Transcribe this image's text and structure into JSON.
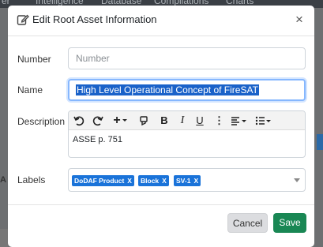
{
  "background": {
    "menu_items": [
      "er",
      "Intelligence",
      "Database",
      "Compilations",
      "Charts"
    ],
    "left_fragment": "A"
  },
  "modal": {
    "title": "Edit Root Asset Information",
    "close_symbol": "×",
    "fields": {
      "number": {
        "label": "Number",
        "placeholder": "Number",
        "value": ""
      },
      "name": {
        "label": "Name",
        "value": "High Level Operational Concept of FireSAT",
        "selected": true
      },
      "description": {
        "label": "Description",
        "value": "ASSE p. 751"
      },
      "labels": {
        "label": "Labels",
        "tags": [
          "DoDAF Product",
          "Block",
          "SV-1"
        ],
        "remove_symbol": "X"
      }
    },
    "toolbar": {
      "bold": "B",
      "italic": "I",
      "underline": "U",
      "more": "⋮",
      "plus": "+"
    },
    "buttons": {
      "cancel": "Cancel",
      "save": "Save"
    },
    "colors": {
      "save": "#198754",
      "tag": "#1a73d9",
      "focus": "#86b7fe",
      "selection": "#1a62c9"
    }
  }
}
